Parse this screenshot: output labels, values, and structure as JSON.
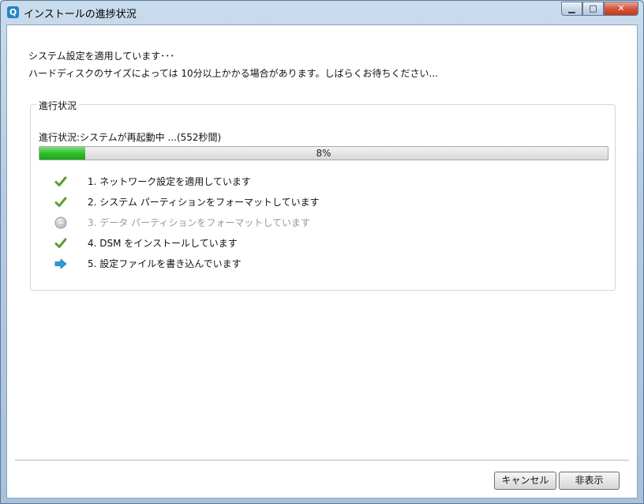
{
  "window": {
    "title": "インストールの進捗状況",
    "app_icon": "Q",
    "controls": {
      "minimize": "▁",
      "maximize": "□",
      "close": "✕"
    }
  },
  "messages": [
    "システム設定を適用しています･･･",
    "ハードディスクのサイズによっては 10分以上かかる場合があります。しばらくお待ちください..."
  ],
  "progress_group": {
    "legend": "進行状況",
    "status": "進行状況:システムが再起動中 ...(552秒間)",
    "percent_label": "8%",
    "percent": 0.08,
    "steps": [
      {
        "label": "1. ネットワーク設定を適用しています",
        "icon": "check-icon",
        "state": "done"
      },
      {
        "label": "2. システム パーティションをフォーマットしています",
        "icon": "check-icon",
        "state": "done"
      },
      {
        "label": "3. データ パーティションをフォーマットしています",
        "icon": "skip-icon",
        "state": "skipped"
      },
      {
        "label": "4. DSM をインストールしています",
        "icon": "check-icon",
        "state": "done"
      },
      {
        "label": "5. 設定ファイルを書き込んでいます",
        "icon": "arrow-right-icon",
        "state": "current"
      }
    ]
  },
  "buttons": {
    "cancel": "キャンセル",
    "hide": "非表示"
  },
  "colors": {
    "check": "#5a9e2f",
    "arrow": "#2a9ad8",
    "progress_fill": "#2fbf2a"
  }
}
